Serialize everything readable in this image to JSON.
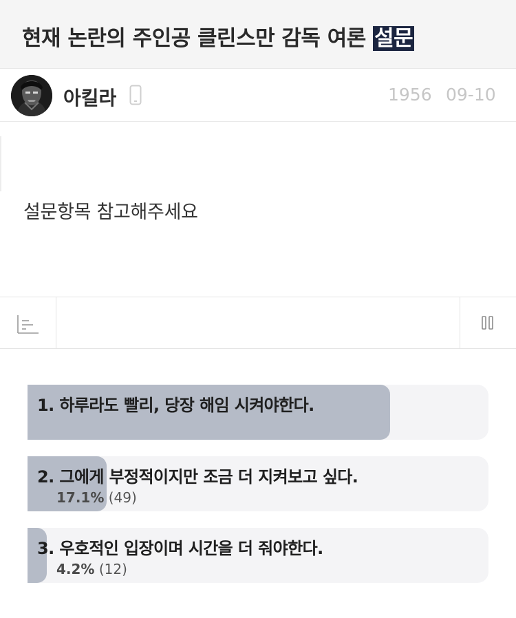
{
  "post": {
    "title": "현재 논란의 주인공 클린스만 감독 여론",
    "title_highlight": "설문",
    "author": "아킬라",
    "views": "1956",
    "date": "09-10",
    "body": "설문항목 참고해주세요"
  },
  "icons": {
    "device": "mobile-phone-icon",
    "toolbar_left": "bar-chart-icon",
    "toolbar_right": "pause-icon"
  },
  "poll": {
    "options": [
      {
        "label": "1. 하루라도 빨리, 당장 해임 시켜야한다.",
        "percent": "",
        "count": "",
        "fill": 0.786
      },
      {
        "label": "2. 그에게 부정적이지만 조금 더 지켜보고 싶다.",
        "percent": "17.1%",
        "count": "(49)",
        "fill": 0.171
      },
      {
        "label": "3. 우호적인 입장이며 시간을 더 줘야한다.",
        "percent": "4.2%",
        "count": "(12)",
        "fill": 0.042
      }
    ]
  },
  "colors": {
    "title_highlight_bg": "#1b2540",
    "poll_fill": "#b5bbc7",
    "poll_track": "#f4f4f6",
    "meta_text": "#c6c6c6"
  }
}
